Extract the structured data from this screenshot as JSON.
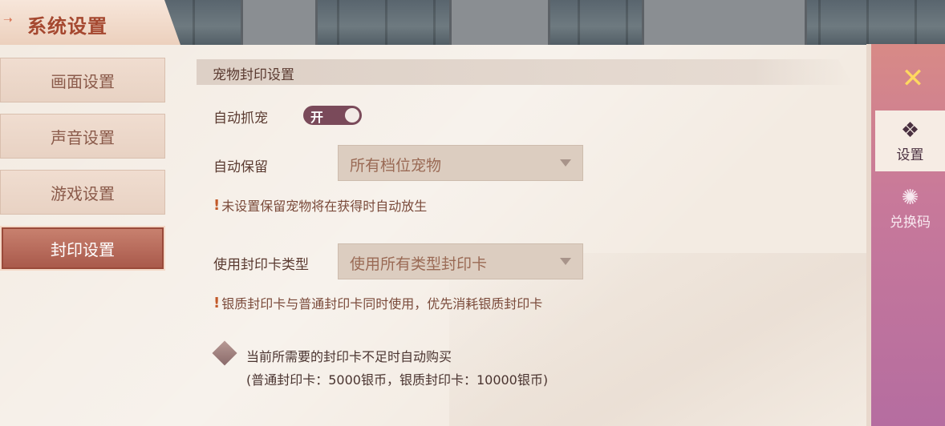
{
  "window": {
    "title": "系统设置"
  },
  "sidebar": {
    "items": [
      {
        "label": "画面设置",
        "active": false
      },
      {
        "label": "声音设置",
        "active": false
      },
      {
        "label": "游戏设置",
        "active": false
      },
      {
        "label": "封印设置",
        "active": true
      }
    ]
  },
  "section": {
    "header": "宠物封印设置"
  },
  "settings": {
    "auto_catch": {
      "label": "自动抓宠",
      "toggle_text": "开",
      "on": true
    },
    "auto_keep": {
      "label": "自动保留",
      "value": "所有档位宠物",
      "hint": "未设置保留宠物将在获得时自动放生"
    },
    "card_type": {
      "label": "使用封印卡类型",
      "value": "使用所有类型封印卡",
      "hint": "银质封印卡与普通封印卡同时使用，优先消耗银质封印卡"
    },
    "auto_buy": {
      "line1": "当前所需要的封印卡不足时自动购买",
      "line2": "(普通封印卡：5000银币，银质封印卡：10000银币)",
      "checked": false
    }
  },
  "right_rail": {
    "close_icon": "close-icon",
    "tabs": [
      {
        "label": "设置",
        "icon": "settings-emblem-icon",
        "active": true
      },
      {
        "label": "兑换码",
        "icon": "redeem-code-icon",
        "active": false
      }
    ]
  },
  "icons": {
    "warn": "warning-icon",
    "title_arrow": "arrow-icon",
    "caret": "caret-down-icon"
  },
  "colors": {
    "accent": "#a54830",
    "toggle": "#7a4a5a",
    "rail": "#c8799a",
    "panel": "#f3ebe2"
  }
}
